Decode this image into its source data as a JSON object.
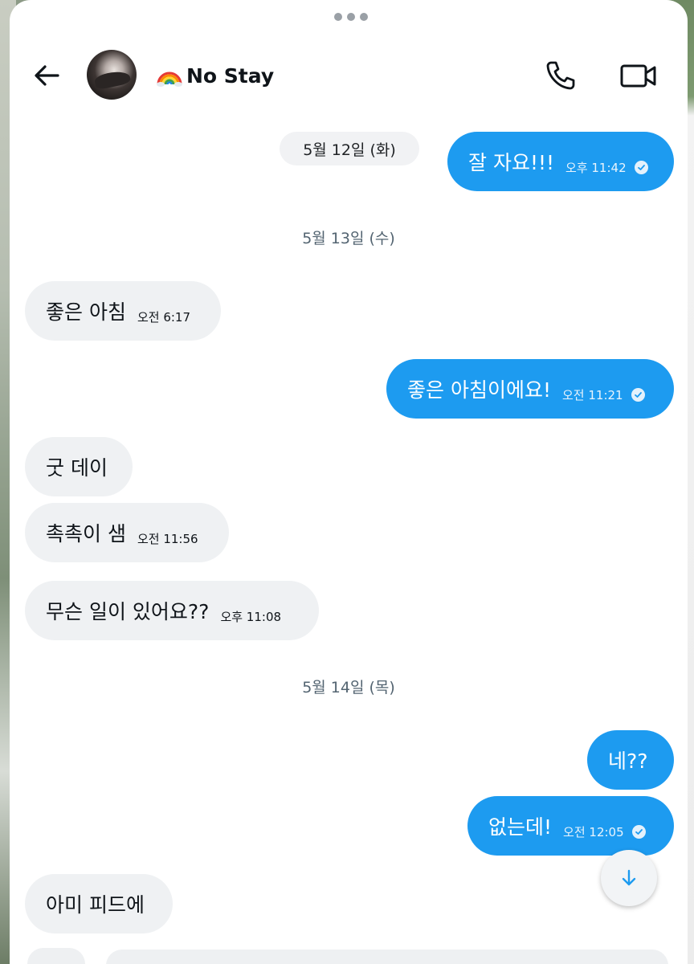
{
  "conversation": {
    "title": "No Stay",
    "title_emoji_icon": "rainbow-icon"
  },
  "header": {
    "back_icon": "arrow-left-icon",
    "call_icon": "phone-icon",
    "video_icon": "video-camera-icon"
  },
  "colors": {
    "outgoing_bubble": "#1d9bf0",
    "incoming_bubble": "#eff1f3",
    "date_text": "#536471"
  },
  "dates": [
    {
      "label": "5월 12일 (화)"
    },
    {
      "label": "5월 13일 (수)"
    },
    {
      "label": "5월 14일 (목)"
    }
  ],
  "messages": [
    {
      "direction": "out",
      "text": "잘 자요!!!",
      "time": "오후 11:42",
      "read": true
    },
    {
      "direction": "in",
      "text": "좋은 아침",
      "time": "오전 6:17"
    },
    {
      "direction": "out",
      "text": "좋은 아침이에요!",
      "time": "오전 11:21",
      "read": true
    },
    {
      "direction": "in",
      "text": "굿 데이",
      "time": ""
    },
    {
      "direction": "in",
      "text": "촉촉이 샘",
      "time": "오전 11:56"
    },
    {
      "direction": "in",
      "text": "무슨 일이 있어요??",
      "time": "오후 11:08"
    },
    {
      "direction": "out",
      "text": "네??",
      "time": ""
    },
    {
      "direction": "out",
      "text": "없는데!",
      "time": "오전 12:05",
      "read": true
    },
    {
      "direction": "in",
      "text": "아미 피드에",
      "time": ""
    }
  ],
  "scroll_down_icon": "arrow-down-icon"
}
